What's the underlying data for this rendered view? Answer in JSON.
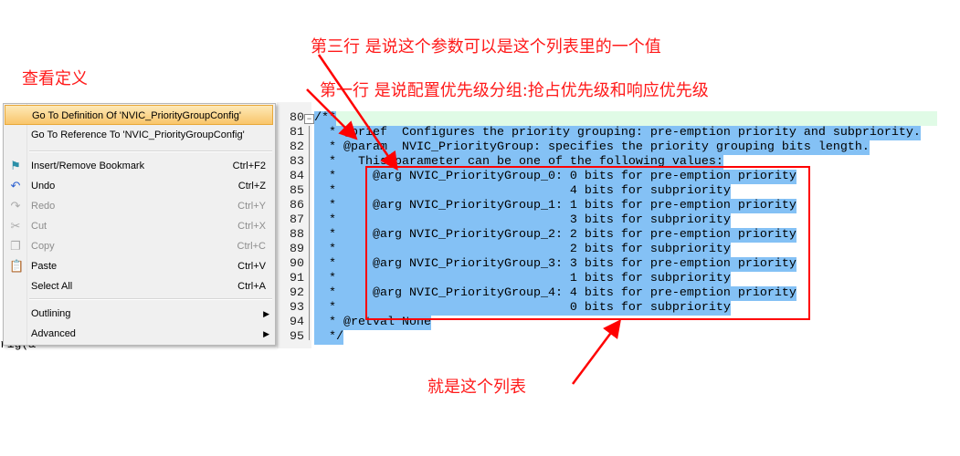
{
  "annotations": {
    "view_definition": "查看定义",
    "line_three": "第三行  是说这个参数可以是这个列表里的一个值",
    "line_one": "第一行  是说配置优先级分组:抢占优先级和响应优先级",
    "this_list": "就是这个列表",
    "color": "#ff0000"
  },
  "background_code": "rig(&",
  "context_menu": {
    "items": [
      {
        "label": "Go To Definition Of 'NVIC_PriorityGroupConfig'",
        "shortcut": "",
        "icon": "",
        "state": "highlighted"
      },
      {
        "label": "Go To Reference To 'NVIC_PriorityGroupConfig'",
        "shortcut": "",
        "icon": "",
        "state": "enabled"
      },
      {
        "label": "Insert/Remove Bookmark",
        "shortcut": "Ctrl+F2",
        "icon": "bookmark-flag-icon",
        "state": "enabled"
      },
      {
        "label": "Undo",
        "shortcut": "Ctrl+Z",
        "icon": "undo-icon",
        "state": "enabled"
      },
      {
        "label": "Redo",
        "shortcut": "Ctrl+Y",
        "icon": "redo-icon",
        "state": "disabled"
      },
      {
        "label": "Cut",
        "shortcut": "Ctrl+X",
        "icon": "scissors-icon",
        "state": "disabled"
      },
      {
        "label": "Copy",
        "shortcut": "Ctrl+C",
        "icon": "copy-icon",
        "state": "disabled"
      },
      {
        "label": "Paste",
        "shortcut": "Ctrl+V",
        "icon": "paste-icon",
        "state": "enabled"
      },
      {
        "label": "Select All",
        "shortcut": "Ctrl+A",
        "icon": "",
        "state": "enabled"
      },
      {
        "label": "Outlining",
        "shortcut": "",
        "icon": "",
        "state": "submenu"
      },
      {
        "label": "Advanced",
        "shortcut": "",
        "icon": "",
        "state": "submenu"
      }
    ]
  },
  "editor": {
    "selection_color": "#84c1f5",
    "current_line_color": "#e0fbe6",
    "lines": [
      {
        "num": "80",
        "text": "/**"
      },
      {
        "num": "81",
        "text": "  * @brief  Configures the priority grouping: pre-emption priority and subpriority."
      },
      {
        "num": "82",
        "text": "  * @param  NVIC_PriorityGroup: specifies the priority grouping bits length."
      },
      {
        "num": "83",
        "text": "  *   This parameter can be one of the following values:"
      },
      {
        "num": "84",
        "text": "  *     @arg NVIC_PriorityGroup_0: 0 bits for pre-emption priority"
      },
      {
        "num": "85",
        "text": "  *                                4 bits for subpriority"
      },
      {
        "num": "86",
        "text": "  *     @arg NVIC_PriorityGroup_1: 1 bits for pre-emption priority"
      },
      {
        "num": "87",
        "text": "  *                                3 bits for subpriority"
      },
      {
        "num": "88",
        "text": "  *     @arg NVIC_PriorityGroup_2: 2 bits for pre-emption priority"
      },
      {
        "num": "89",
        "text": "  *                                2 bits for subpriority"
      },
      {
        "num": "90",
        "text": "  *     @arg NVIC_PriorityGroup_3: 3 bits for pre-emption priority"
      },
      {
        "num": "91",
        "text": "  *                                1 bits for subpriority"
      },
      {
        "num": "92",
        "text": "  *     @arg NVIC_PriorityGroup_4: 4 bits for pre-emption priority"
      },
      {
        "num": "93",
        "text": "  *                                0 bits for subpriority"
      },
      {
        "num": "94",
        "text": "  * @retval None"
      },
      {
        "num": "95",
        "text": "  */"
      }
    ]
  }
}
